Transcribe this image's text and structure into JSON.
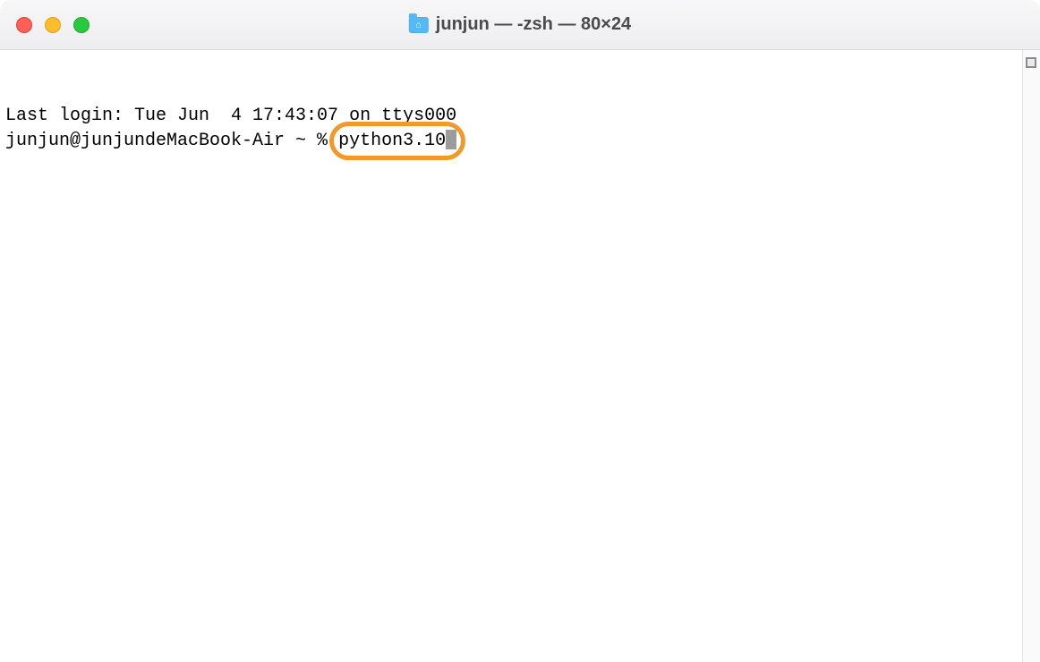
{
  "window": {
    "title": "junjun — -zsh — 80×24"
  },
  "terminal": {
    "last_login_line": "Last login: Tue Jun  4 17:43:07 on ttys000",
    "prompt": "junjun@junjundeMacBook-Air ~ % ",
    "typed_command": "python3.10"
  },
  "annotation": {
    "highlight_target": "python3.10"
  }
}
